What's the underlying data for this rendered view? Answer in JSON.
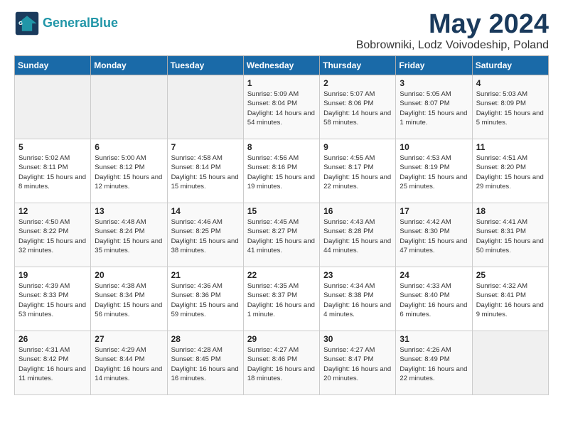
{
  "header": {
    "logo_line1": "General",
    "logo_line2": "Blue",
    "month": "May 2024",
    "subtitle": "Bobrowniki, Lodz Voivodeship, Poland"
  },
  "weekdays": [
    "Sunday",
    "Monday",
    "Tuesday",
    "Wednesday",
    "Thursday",
    "Friday",
    "Saturday"
  ],
  "weeks": [
    [
      {
        "day": "",
        "sunrise": "",
        "sunset": "",
        "daylight": ""
      },
      {
        "day": "",
        "sunrise": "",
        "sunset": "",
        "daylight": ""
      },
      {
        "day": "",
        "sunrise": "",
        "sunset": "",
        "daylight": ""
      },
      {
        "day": "1",
        "sunrise": "Sunrise: 5:09 AM",
        "sunset": "Sunset: 8:04 PM",
        "daylight": "Daylight: 14 hours and 54 minutes."
      },
      {
        "day": "2",
        "sunrise": "Sunrise: 5:07 AM",
        "sunset": "Sunset: 8:06 PM",
        "daylight": "Daylight: 14 hours and 58 minutes."
      },
      {
        "day": "3",
        "sunrise": "Sunrise: 5:05 AM",
        "sunset": "Sunset: 8:07 PM",
        "daylight": "Daylight: 15 hours and 1 minute."
      },
      {
        "day": "4",
        "sunrise": "Sunrise: 5:03 AM",
        "sunset": "Sunset: 8:09 PM",
        "daylight": "Daylight: 15 hours and 5 minutes."
      }
    ],
    [
      {
        "day": "5",
        "sunrise": "Sunrise: 5:02 AM",
        "sunset": "Sunset: 8:11 PM",
        "daylight": "Daylight: 15 hours and 8 minutes."
      },
      {
        "day": "6",
        "sunrise": "Sunrise: 5:00 AM",
        "sunset": "Sunset: 8:12 PM",
        "daylight": "Daylight: 15 hours and 12 minutes."
      },
      {
        "day": "7",
        "sunrise": "Sunrise: 4:58 AM",
        "sunset": "Sunset: 8:14 PM",
        "daylight": "Daylight: 15 hours and 15 minutes."
      },
      {
        "day": "8",
        "sunrise": "Sunrise: 4:56 AM",
        "sunset": "Sunset: 8:16 PM",
        "daylight": "Daylight: 15 hours and 19 minutes."
      },
      {
        "day": "9",
        "sunrise": "Sunrise: 4:55 AM",
        "sunset": "Sunset: 8:17 PM",
        "daylight": "Daylight: 15 hours and 22 minutes."
      },
      {
        "day": "10",
        "sunrise": "Sunrise: 4:53 AM",
        "sunset": "Sunset: 8:19 PM",
        "daylight": "Daylight: 15 hours and 25 minutes."
      },
      {
        "day": "11",
        "sunrise": "Sunrise: 4:51 AM",
        "sunset": "Sunset: 8:20 PM",
        "daylight": "Daylight: 15 hours and 29 minutes."
      }
    ],
    [
      {
        "day": "12",
        "sunrise": "Sunrise: 4:50 AM",
        "sunset": "Sunset: 8:22 PM",
        "daylight": "Daylight: 15 hours and 32 minutes."
      },
      {
        "day": "13",
        "sunrise": "Sunrise: 4:48 AM",
        "sunset": "Sunset: 8:24 PM",
        "daylight": "Daylight: 15 hours and 35 minutes."
      },
      {
        "day": "14",
        "sunrise": "Sunrise: 4:46 AM",
        "sunset": "Sunset: 8:25 PM",
        "daylight": "Daylight: 15 hours and 38 minutes."
      },
      {
        "day": "15",
        "sunrise": "Sunrise: 4:45 AM",
        "sunset": "Sunset: 8:27 PM",
        "daylight": "Daylight: 15 hours and 41 minutes."
      },
      {
        "day": "16",
        "sunrise": "Sunrise: 4:43 AM",
        "sunset": "Sunset: 8:28 PM",
        "daylight": "Daylight: 15 hours and 44 minutes."
      },
      {
        "day": "17",
        "sunrise": "Sunrise: 4:42 AM",
        "sunset": "Sunset: 8:30 PM",
        "daylight": "Daylight: 15 hours and 47 minutes."
      },
      {
        "day": "18",
        "sunrise": "Sunrise: 4:41 AM",
        "sunset": "Sunset: 8:31 PM",
        "daylight": "Daylight: 15 hours and 50 minutes."
      }
    ],
    [
      {
        "day": "19",
        "sunrise": "Sunrise: 4:39 AM",
        "sunset": "Sunset: 8:33 PM",
        "daylight": "Daylight: 15 hours and 53 minutes."
      },
      {
        "day": "20",
        "sunrise": "Sunrise: 4:38 AM",
        "sunset": "Sunset: 8:34 PM",
        "daylight": "Daylight: 15 hours and 56 minutes."
      },
      {
        "day": "21",
        "sunrise": "Sunrise: 4:36 AM",
        "sunset": "Sunset: 8:36 PM",
        "daylight": "Daylight: 15 hours and 59 minutes."
      },
      {
        "day": "22",
        "sunrise": "Sunrise: 4:35 AM",
        "sunset": "Sunset: 8:37 PM",
        "daylight": "Daylight: 16 hours and 1 minute."
      },
      {
        "day": "23",
        "sunrise": "Sunrise: 4:34 AM",
        "sunset": "Sunset: 8:38 PM",
        "daylight": "Daylight: 16 hours and 4 minutes."
      },
      {
        "day": "24",
        "sunrise": "Sunrise: 4:33 AM",
        "sunset": "Sunset: 8:40 PM",
        "daylight": "Daylight: 16 hours and 6 minutes."
      },
      {
        "day": "25",
        "sunrise": "Sunrise: 4:32 AM",
        "sunset": "Sunset: 8:41 PM",
        "daylight": "Daylight: 16 hours and 9 minutes."
      }
    ],
    [
      {
        "day": "26",
        "sunrise": "Sunrise: 4:31 AM",
        "sunset": "Sunset: 8:42 PM",
        "daylight": "Daylight: 16 hours and 11 minutes."
      },
      {
        "day": "27",
        "sunrise": "Sunrise: 4:29 AM",
        "sunset": "Sunset: 8:44 PM",
        "daylight": "Daylight: 16 hours and 14 minutes."
      },
      {
        "day": "28",
        "sunrise": "Sunrise: 4:28 AM",
        "sunset": "Sunset: 8:45 PM",
        "daylight": "Daylight: 16 hours and 16 minutes."
      },
      {
        "day": "29",
        "sunrise": "Sunrise: 4:27 AM",
        "sunset": "Sunset: 8:46 PM",
        "daylight": "Daylight: 16 hours and 18 minutes."
      },
      {
        "day": "30",
        "sunrise": "Sunrise: 4:27 AM",
        "sunset": "Sunset: 8:47 PM",
        "daylight": "Daylight: 16 hours and 20 minutes."
      },
      {
        "day": "31",
        "sunrise": "Sunrise: 4:26 AM",
        "sunset": "Sunset: 8:49 PM",
        "daylight": "Daylight: 16 hours and 22 minutes."
      },
      {
        "day": "",
        "sunrise": "",
        "sunset": "",
        "daylight": ""
      }
    ]
  ]
}
